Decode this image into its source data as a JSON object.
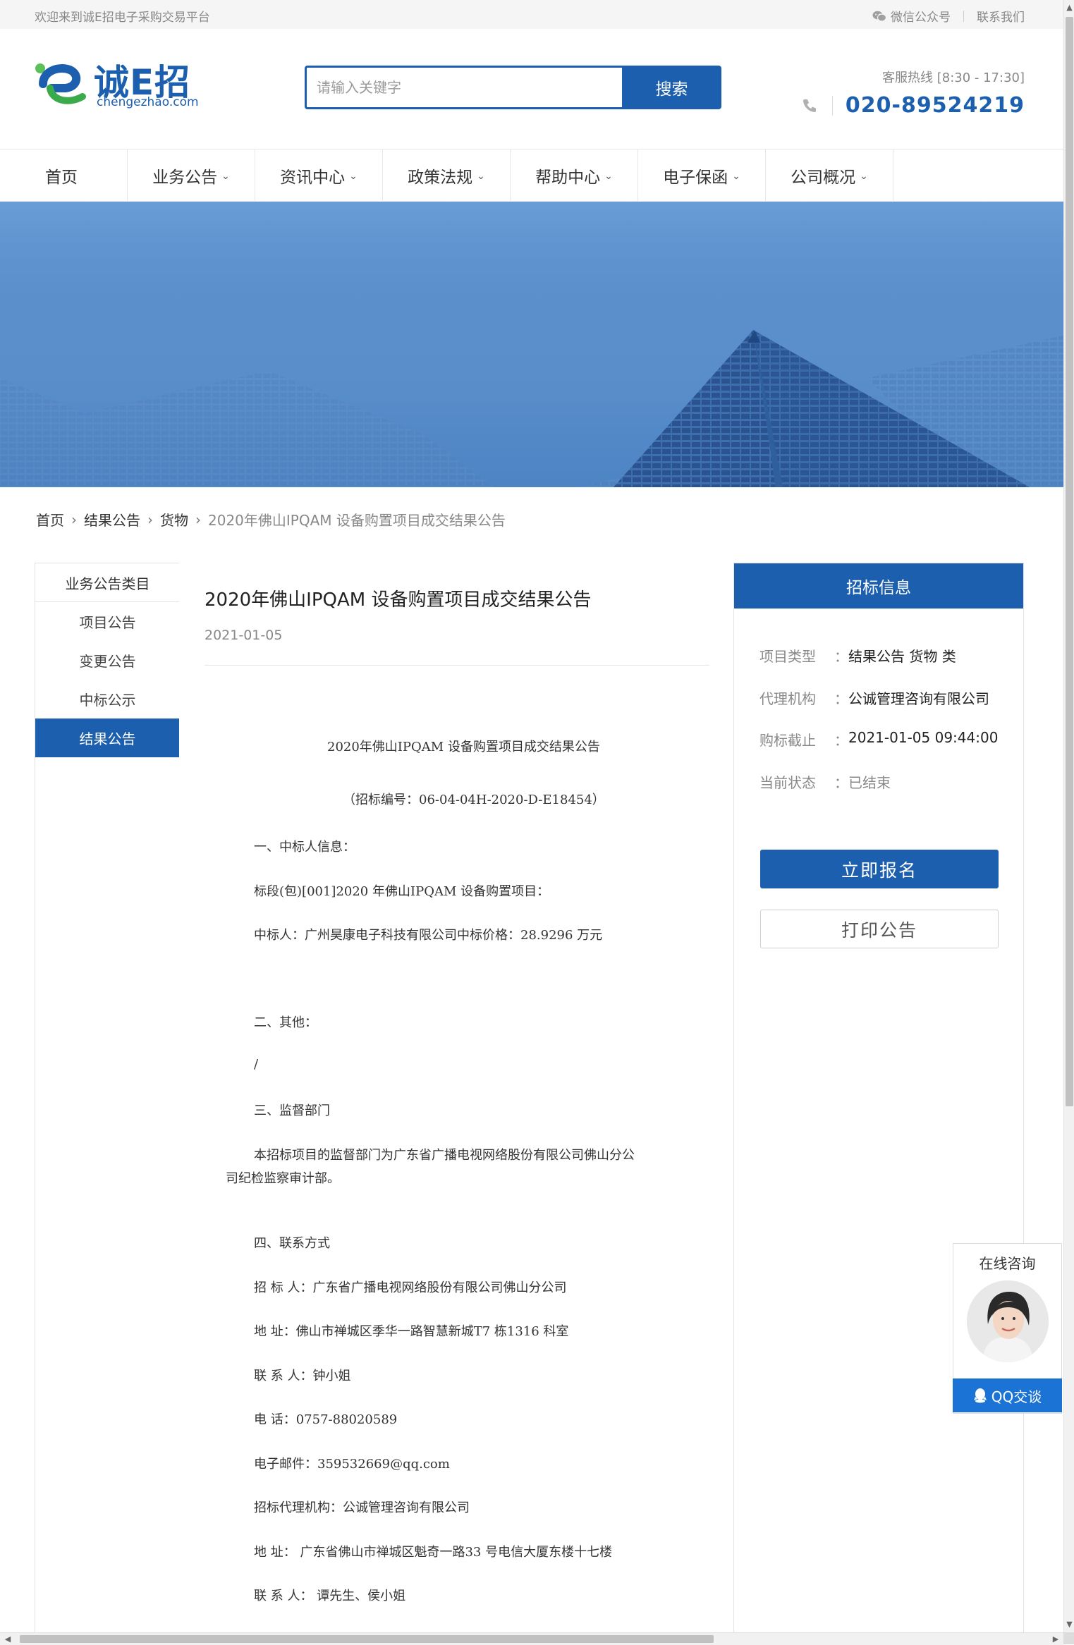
{
  "topbar": {
    "welcome": "欢迎来到诚E招电子采购交易平台",
    "wechat": "微信公众号",
    "contact": "联系我们"
  },
  "header": {
    "logo_name": "诚E招",
    "logo_url": "chengezhao.com",
    "search_placeholder": "请输入关键字",
    "search_button": "搜索",
    "hotline_label": "客服热线 [8:30 - 17:30]",
    "hotline_number": "020-89524219"
  },
  "nav": [
    {
      "label": "首页",
      "has_dropdown": false
    },
    {
      "label": "业务公告",
      "has_dropdown": true
    },
    {
      "label": "资讯中心",
      "has_dropdown": true
    },
    {
      "label": "政策法规",
      "has_dropdown": true
    },
    {
      "label": "帮助中心",
      "has_dropdown": true
    },
    {
      "label": "电子保函",
      "has_dropdown": true
    },
    {
      "label": "公司概况",
      "has_dropdown": true
    }
  ],
  "breadcrumb": [
    "首页",
    "结果公告",
    "货物",
    "2020年佛山IPQAM 设备购置项目成交结果公告"
  ],
  "sidebar": {
    "title": "业务公告类目",
    "items": [
      "项目公告",
      "变更公告",
      "中标公示",
      "结果公告"
    ],
    "active_index": 3
  },
  "article": {
    "title": "2020年佛山IPQAM 设备购置项目成交结果公告",
    "date": "2021-01-05",
    "lines": [
      "2020年佛山IPQAM 设备购置项目成交结果公告",
      "（招标编号：06-04-04H-2020-D-E18454）",
      "一、中标人信息：",
      "标段(包)[001]2020 年佛山IPQAM 设备购置项目：",
      "中标人：广州昊康电子科技有限公司中标价格：28.9296 万元",
      "二、其他：",
      "/",
      "三、监督部门",
      "本招标项目的监督部门为广东省广播电视网络股份有限公司佛山分公",
      "司纪检监察审计部。",
      "四、联系方式",
      "招 标 人：广东省广播电视网络股份有限公司佛山分公司",
      "地 址：佛山市禅城区季华一路智慧新城T7 栋1316 科室",
      "联 系 人：钟小姐",
      "电 话：0757-88020589",
      "电子邮件：359532669@qq.com",
      "招标代理机构：公诚管理咨询有限公司",
      "地 址： 广东省佛山市禅城区魁奇一路33 号电信大厦东楼十七楼",
      "联 系 人： 谭先生、侯小姐"
    ]
  },
  "info": {
    "title": "招标信息",
    "rows": [
      {
        "key": "项目类型",
        "value": "结果公告 货物 类"
      },
      {
        "key": "代理机构",
        "value": "公诚管理咨询有限公司"
      },
      {
        "key": "购标截止",
        "value": "2021-01-05 09:44:00"
      },
      {
        "key": "当前状态",
        "value": "已结束"
      }
    ],
    "colon": "：",
    "signup_button": "立即报名",
    "print_button": "打印公告"
  },
  "consult": {
    "title": "在线咨询",
    "qq_button": "QQ交谈"
  },
  "colors": {
    "brand": "#1c5fae",
    "qq": "#1c73d6",
    "banner": "#5a8ecb"
  },
  "icons": [
    "wechat-icon",
    "phone-icon",
    "chevron-down-icon",
    "chevron-right-icon",
    "qq-icon",
    "avatar"
  ]
}
